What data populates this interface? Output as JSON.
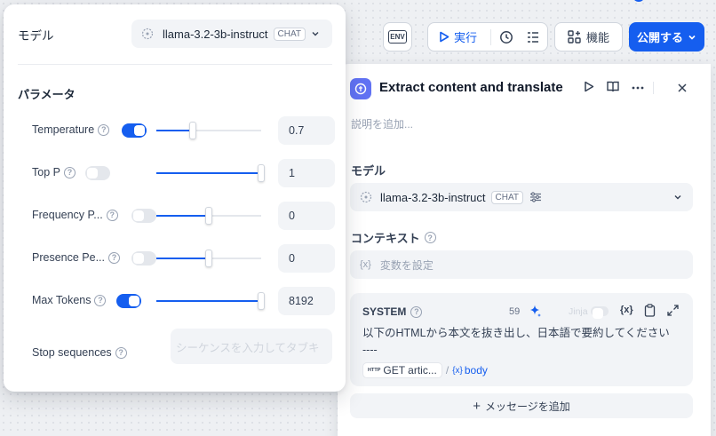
{
  "toolbar": {
    "env_label": "ENV",
    "run_label": "実行",
    "features_label": "機能",
    "publish_label": "公開する"
  },
  "node": {
    "title": "Extract content and translate",
    "description_placeholder": "説明を追加...",
    "model_section": "モデル",
    "model_name": "llama-3.2-3b-instruct",
    "model_badge": "CHAT",
    "context_section": "コンテキスト",
    "context_placeholder": "変数を設定",
    "system": {
      "label": "SYSTEM",
      "token_count": "59",
      "jinja_label": "Jinja",
      "line1": "以下のHTMLから本文を抜き出し、日本語で要約してください",
      "line2": "----",
      "var_node": "GET artic...",
      "var_sep": "/",
      "var_name": "body"
    },
    "add_message": "メッセージを追加"
  },
  "popover": {
    "model_label": "モデル",
    "model_name": "llama-3.2-3b-instruct",
    "model_badge": "CHAT",
    "params_title": "パラメータ",
    "params": [
      {
        "label": "Temperature",
        "enabled": true,
        "value": "0.7",
        "fraction": 0.35
      },
      {
        "label": "Top P",
        "enabled": false,
        "value": "1",
        "fraction": 1.0
      },
      {
        "label": "Frequency P...",
        "enabled": false,
        "value": "0",
        "fraction": 0.5
      },
      {
        "label": "Presence Pe...",
        "enabled": false,
        "value": "0",
        "fraction": 0.5
      },
      {
        "label": "Max Tokens",
        "enabled": true,
        "value": "8192",
        "fraction": 1.0
      }
    ],
    "stop_label": "Stop sequences",
    "stop_placeholder": "シーケンスを入力してタブキ"
  },
  "colors": {
    "accent": "#155eef",
    "node_icon": "#6172f3"
  }
}
